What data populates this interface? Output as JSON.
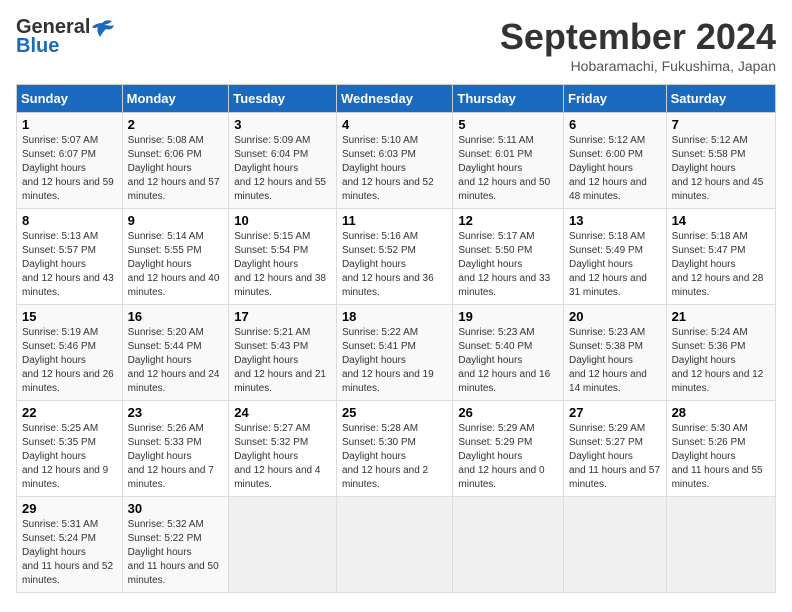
{
  "header": {
    "logo_general": "General",
    "logo_blue": "Blue",
    "month": "September 2024",
    "location": "Hobaramachi, Fukushima, Japan"
  },
  "weekdays": [
    "Sunday",
    "Monday",
    "Tuesday",
    "Wednesday",
    "Thursday",
    "Friday",
    "Saturday"
  ],
  "weeks": [
    [
      {
        "day": "1",
        "sunrise": "5:07 AM",
        "sunset": "6:07 PM",
        "daylight": "12 hours and 59 minutes."
      },
      {
        "day": "2",
        "sunrise": "5:08 AM",
        "sunset": "6:06 PM",
        "daylight": "12 hours and 57 minutes."
      },
      {
        "day": "3",
        "sunrise": "5:09 AM",
        "sunset": "6:04 PM",
        "daylight": "12 hours and 55 minutes."
      },
      {
        "day": "4",
        "sunrise": "5:10 AM",
        "sunset": "6:03 PM",
        "daylight": "12 hours and 52 minutes."
      },
      {
        "day": "5",
        "sunrise": "5:11 AM",
        "sunset": "6:01 PM",
        "daylight": "12 hours and 50 minutes."
      },
      {
        "day": "6",
        "sunrise": "5:12 AM",
        "sunset": "6:00 PM",
        "daylight": "12 hours and 48 minutes."
      },
      {
        "day": "7",
        "sunrise": "5:12 AM",
        "sunset": "5:58 PM",
        "daylight": "12 hours and 45 minutes."
      }
    ],
    [
      {
        "day": "8",
        "sunrise": "5:13 AM",
        "sunset": "5:57 PM",
        "daylight": "12 hours and 43 minutes."
      },
      {
        "day": "9",
        "sunrise": "5:14 AM",
        "sunset": "5:55 PM",
        "daylight": "12 hours and 40 minutes."
      },
      {
        "day": "10",
        "sunrise": "5:15 AM",
        "sunset": "5:54 PM",
        "daylight": "12 hours and 38 minutes."
      },
      {
        "day": "11",
        "sunrise": "5:16 AM",
        "sunset": "5:52 PM",
        "daylight": "12 hours and 36 minutes."
      },
      {
        "day": "12",
        "sunrise": "5:17 AM",
        "sunset": "5:50 PM",
        "daylight": "12 hours and 33 minutes."
      },
      {
        "day": "13",
        "sunrise": "5:18 AM",
        "sunset": "5:49 PM",
        "daylight": "12 hours and 31 minutes."
      },
      {
        "day": "14",
        "sunrise": "5:18 AM",
        "sunset": "5:47 PM",
        "daylight": "12 hours and 28 minutes."
      }
    ],
    [
      {
        "day": "15",
        "sunrise": "5:19 AM",
        "sunset": "5:46 PM",
        "daylight": "12 hours and 26 minutes."
      },
      {
        "day": "16",
        "sunrise": "5:20 AM",
        "sunset": "5:44 PM",
        "daylight": "12 hours and 24 minutes."
      },
      {
        "day": "17",
        "sunrise": "5:21 AM",
        "sunset": "5:43 PM",
        "daylight": "12 hours and 21 minutes."
      },
      {
        "day": "18",
        "sunrise": "5:22 AM",
        "sunset": "5:41 PM",
        "daylight": "12 hours and 19 minutes."
      },
      {
        "day": "19",
        "sunrise": "5:23 AM",
        "sunset": "5:40 PM",
        "daylight": "12 hours and 16 minutes."
      },
      {
        "day": "20",
        "sunrise": "5:23 AM",
        "sunset": "5:38 PM",
        "daylight": "12 hours and 14 minutes."
      },
      {
        "day": "21",
        "sunrise": "5:24 AM",
        "sunset": "5:36 PM",
        "daylight": "12 hours and 12 minutes."
      }
    ],
    [
      {
        "day": "22",
        "sunrise": "5:25 AM",
        "sunset": "5:35 PM",
        "daylight": "12 hours and 9 minutes."
      },
      {
        "day": "23",
        "sunrise": "5:26 AM",
        "sunset": "5:33 PM",
        "daylight": "12 hours and 7 minutes."
      },
      {
        "day": "24",
        "sunrise": "5:27 AM",
        "sunset": "5:32 PM",
        "daylight": "12 hours and 4 minutes."
      },
      {
        "day": "25",
        "sunrise": "5:28 AM",
        "sunset": "5:30 PM",
        "daylight": "12 hours and 2 minutes."
      },
      {
        "day": "26",
        "sunrise": "5:29 AM",
        "sunset": "5:29 PM",
        "daylight": "12 hours and 0 minutes."
      },
      {
        "day": "27",
        "sunrise": "5:29 AM",
        "sunset": "5:27 PM",
        "daylight": "11 hours and 57 minutes."
      },
      {
        "day": "28",
        "sunrise": "5:30 AM",
        "sunset": "5:26 PM",
        "daylight": "11 hours and 55 minutes."
      }
    ],
    [
      {
        "day": "29",
        "sunrise": "5:31 AM",
        "sunset": "5:24 PM",
        "daylight": "11 hours and 52 minutes."
      },
      {
        "day": "30",
        "sunrise": "5:32 AM",
        "sunset": "5:22 PM",
        "daylight": "11 hours and 50 minutes."
      },
      null,
      null,
      null,
      null,
      null
    ]
  ]
}
